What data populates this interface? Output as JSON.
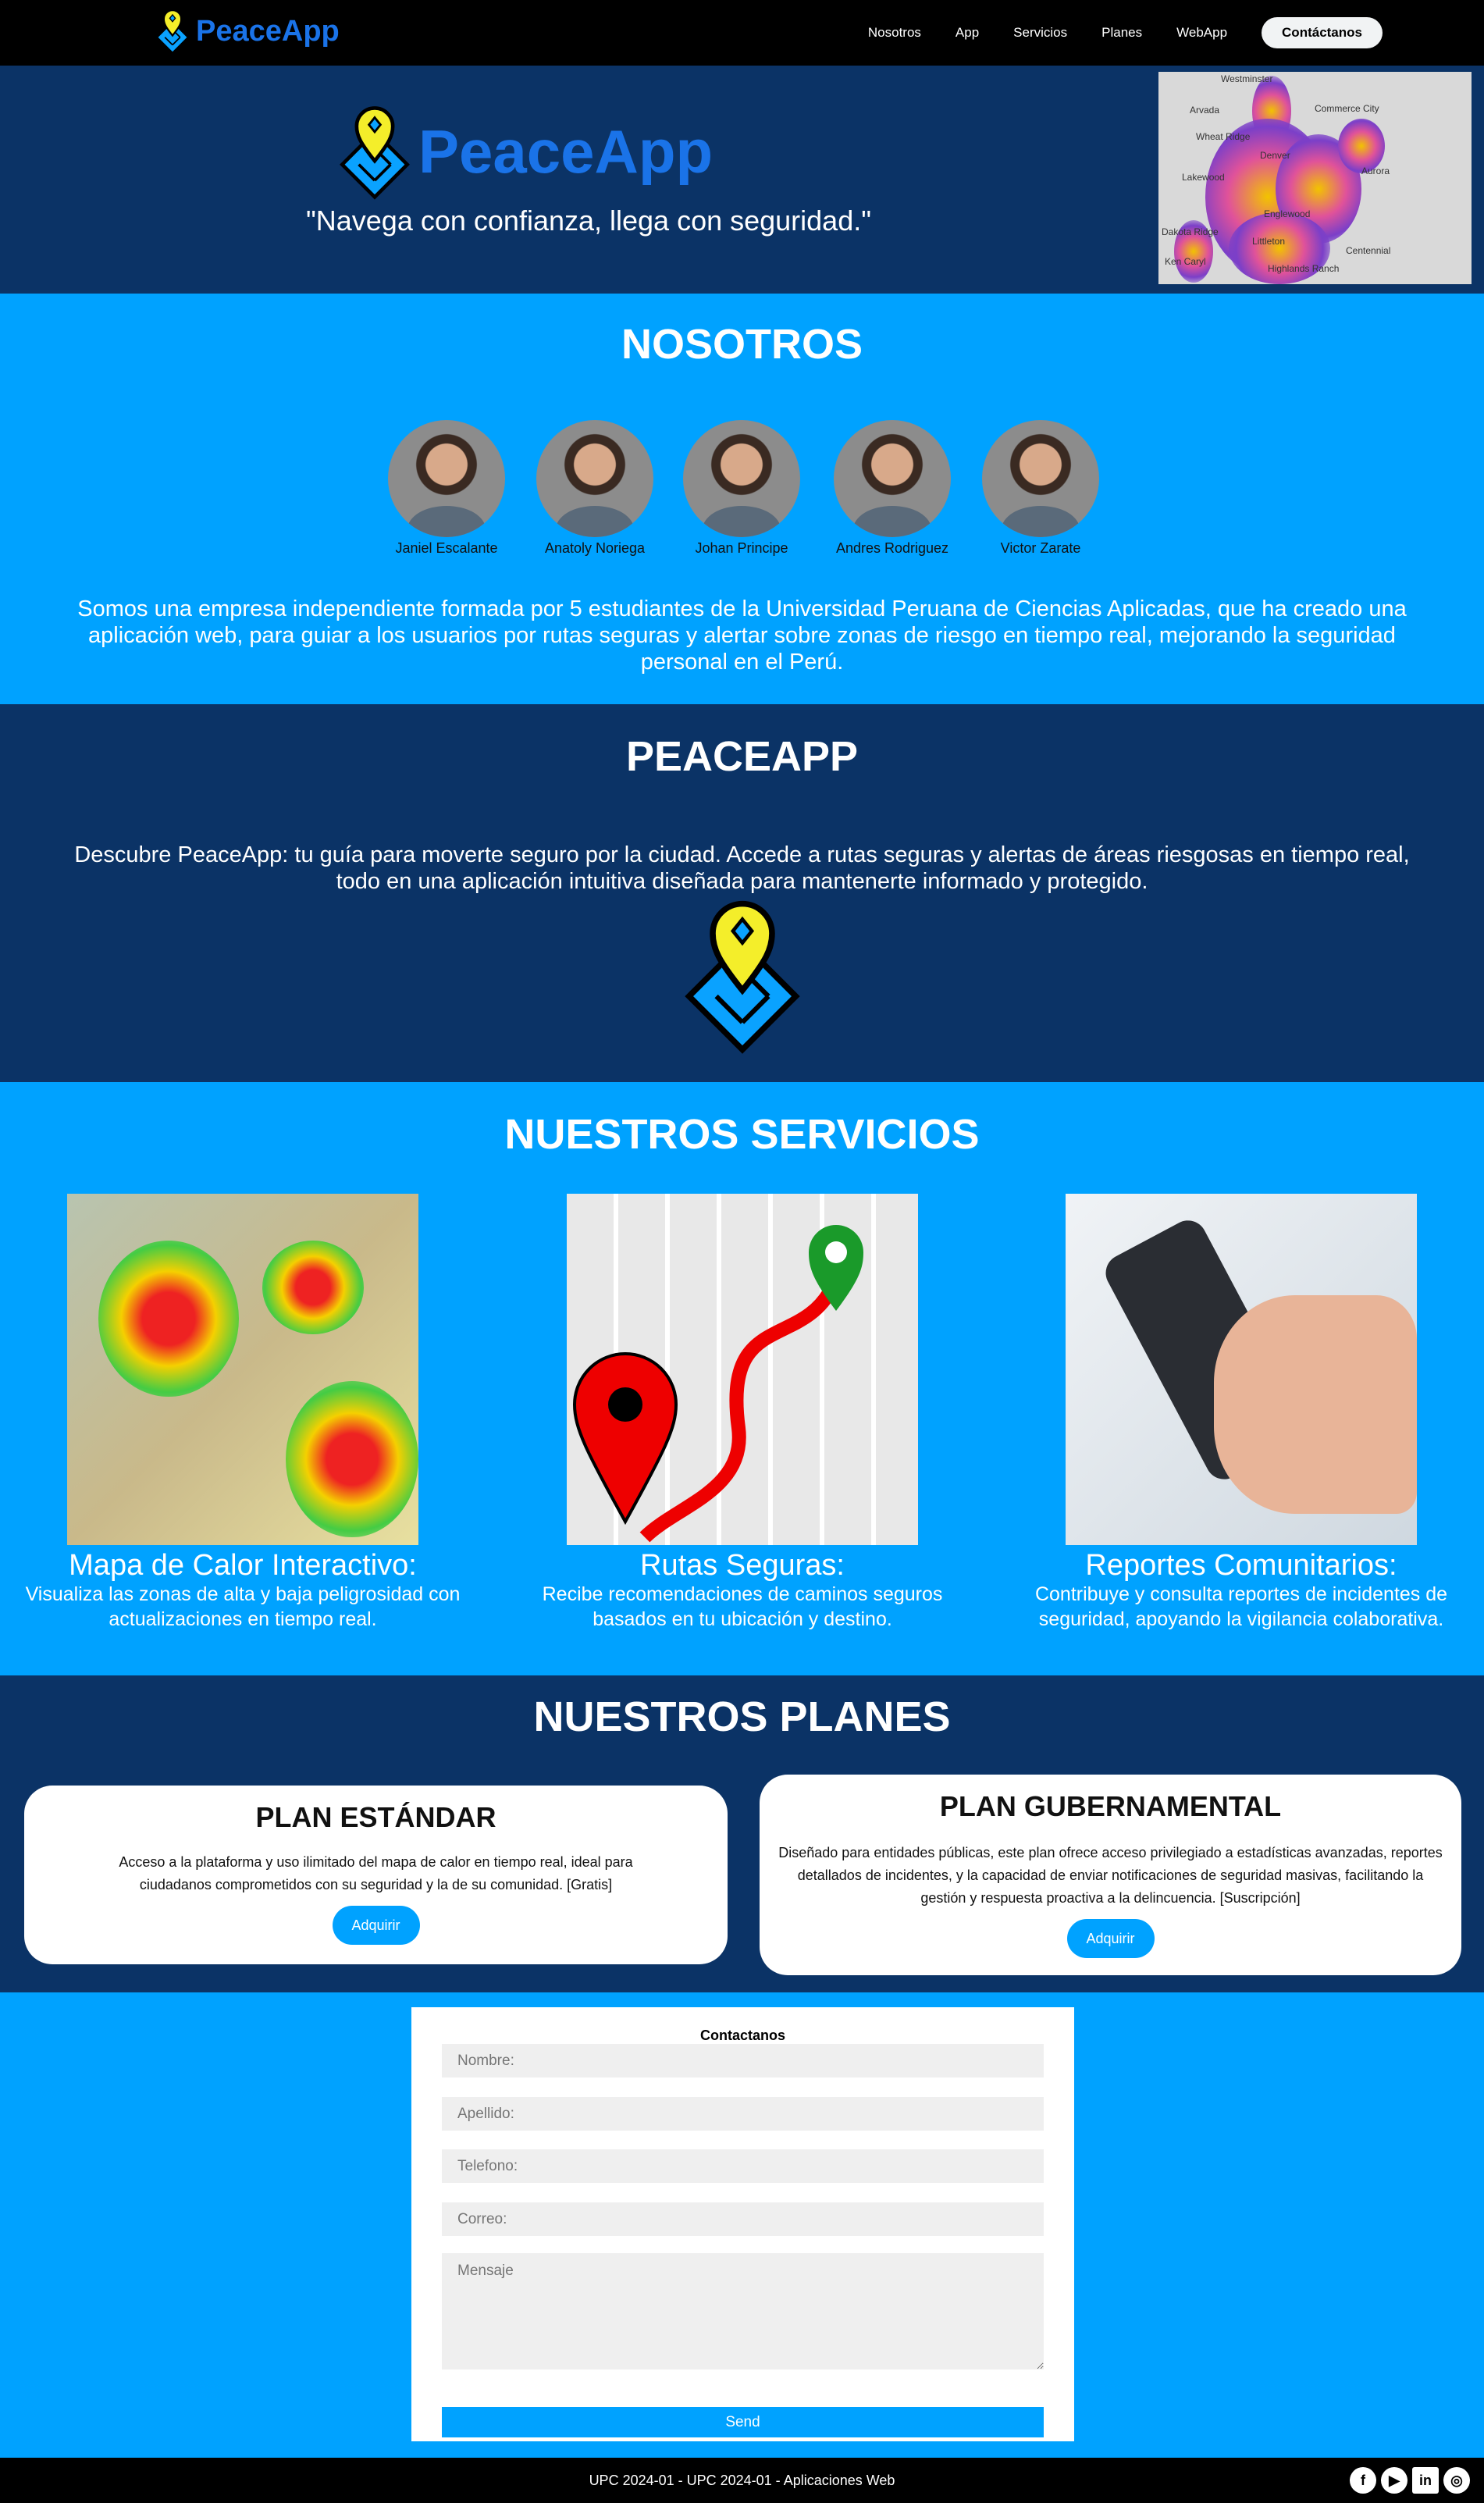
{
  "nav": {
    "brand": "PeaceApp",
    "links": [
      "Nosotros",
      "App",
      "Servicios",
      "Planes",
      "WebApp"
    ],
    "cta": "Contáctanos"
  },
  "hero": {
    "brand": "PeaceApp",
    "tagline": "\"Navega con confianza, llega con seguridad.\"",
    "map_labels": [
      "Westminster",
      "Arvada",
      "Commerce City",
      "Wheat Ridge",
      "Denver",
      "Aurora",
      "Lakewood",
      "Englewood",
      "Dakota Ridge",
      "Littleton",
      "Centennial",
      "Ken Caryl",
      "Highlands Ranch"
    ]
  },
  "nosotros": {
    "title": "NOSOTROS",
    "members": [
      "Janiel Escalante",
      "Anatoly Noriega",
      "Johan Principe",
      "Andres Rodriguez",
      "Victor Zarate"
    ],
    "text": "Somos una empresa independiente formada por 5 estudiantes de la Universidad Peruana de Ciencias Aplicadas, que ha creado una aplicación web, para guiar a los usuarios por rutas seguras y alertar sobre zonas de riesgo en tiempo real, mejorando la seguridad personal en el Perú."
  },
  "peaceapp": {
    "title": "PEACEAPP",
    "text": "Descubre PeaceApp: tu guía para moverte seguro por la ciudad. Accede a rutas seguras y alertas de áreas riesgosas en tiempo real, todo en una aplicación intuitiva diseñada para mantenerte informado y protegido."
  },
  "servicios": {
    "title": "NUESTROS SERVICIOS",
    "items": [
      {
        "title": "Mapa de Calor Interactivo:",
        "desc": "Visualiza las zonas de alta y baja peligrosidad con actualizaciones en tiempo real."
      },
      {
        "title": "Rutas Seguras:",
        "desc": "Recibe recomendaciones de caminos seguros basados en tu ubicación y destino."
      },
      {
        "title": "Reportes Comunitarios:",
        "desc": "Contribuye y consulta reportes de incidentes de seguridad, apoyando la vigilancia colaborativa."
      }
    ]
  },
  "planes": {
    "title": "NUESTROS PLANES",
    "items": [
      {
        "title": "PLAN ESTÁNDAR",
        "desc": "Acceso a la plataforma y uso ilimitado del mapa de calor en tiempo real, ideal para ciudadanos comprometidos con su seguridad y la de su comunidad. [Gratis]",
        "button": "Adquirir"
      },
      {
        "title": "PLAN GUBERNAMENTAL",
        "desc": "Diseñado para entidades públicas, este plan ofrece acceso privilegiado a estadísticas avanzadas, reportes detallados de incidentes, y la capacidad de enviar notificaciones de seguridad masivas, facilitando la gestión y respuesta proactiva a la delincuencia. [Suscripción]",
        "button": "Adquirir"
      }
    ]
  },
  "contacto": {
    "title": "Contactanos",
    "fields": {
      "nombre": "Nombre:",
      "apellido": "Apellido:",
      "telefono": "Telefono:",
      "correo": "Correo:",
      "mensaje": "Mensaje"
    },
    "send": "Send"
  },
  "footer": {
    "text": "UPC 2024-01 - UPC 2024-01 - Aplicaciones Web",
    "social": [
      "facebook",
      "youtube",
      "linkedin",
      "instagram"
    ]
  },
  "colors": {
    "nav": "#000000",
    "dark": "#0b3366",
    "accent": "#00a2ff",
    "brand": "#1a73e8"
  }
}
